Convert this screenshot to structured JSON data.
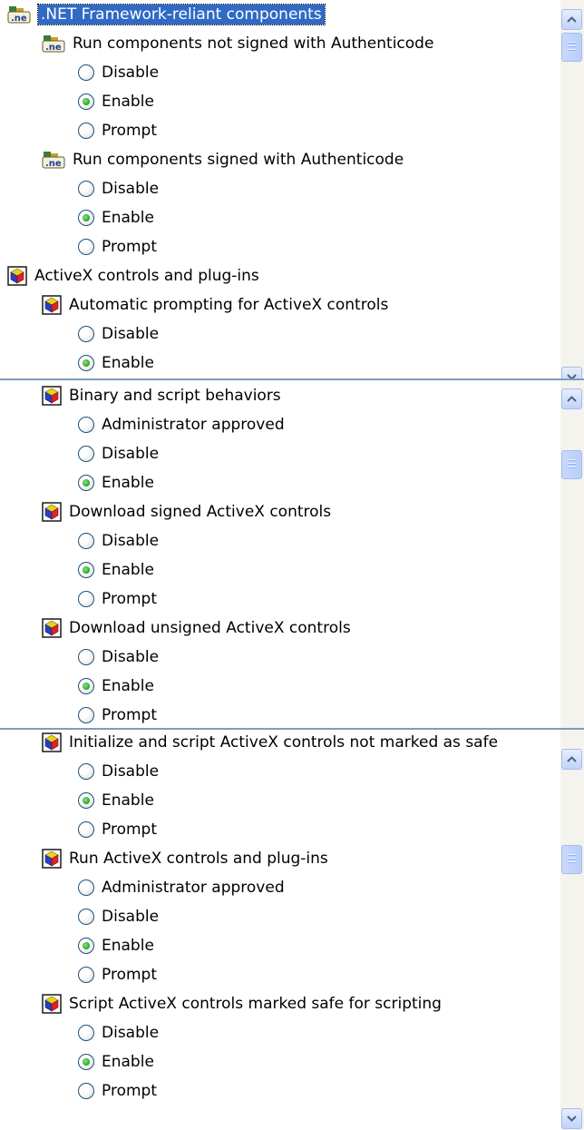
{
  "panels": [
    {
      "rows": [
        {
          "level": 0,
          "kind": "group",
          "icon": "net-components-icon",
          "label": ".NET Framework-reliant components",
          "selected": true
        },
        {
          "level": 1,
          "kind": "setting",
          "icon": "net-components-icon",
          "label": "Run components not signed with Authenticode"
        },
        {
          "level": 2,
          "kind": "option",
          "label": "Disable",
          "checked": false
        },
        {
          "level": 2,
          "kind": "option",
          "label": "Enable",
          "checked": true
        },
        {
          "level": 2,
          "kind": "option",
          "label": "Prompt",
          "checked": false
        },
        {
          "level": 1,
          "kind": "setting",
          "icon": "net-components-icon",
          "label": "Run components signed with Authenticode"
        },
        {
          "level": 2,
          "kind": "option",
          "label": "Disable",
          "checked": false
        },
        {
          "level": 2,
          "kind": "option",
          "label": "Enable",
          "checked": true
        },
        {
          "level": 2,
          "kind": "option",
          "label": "Prompt",
          "checked": false
        },
        {
          "level": 0,
          "kind": "group",
          "icon": "activex-icon",
          "label": "ActiveX controls and plug-ins"
        },
        {
          "level": 1,
          "kind": "setting",
          "icon": "activex-icon",
          "label": "Automatic prompting for ActiveX controls"
        },
        {
          "level": 2,
          "kind": "option",
          "label": "Disable",
          "checked": false
        },
        {
          "level": 2,
          "kind": "option",
          "label": "Enable",
          "checked": true
        }
      ]
    },
    {
      "rows": [
        {
          "level": 1,
          "kind": "setting",
          "icon": "activex-icon",
          "label": "Binary and script behaviors"
        },
        {
          "level": 2,
          "kind": "option",
          "label": "Administrator approved",
          "checked": false
        },
        {
          "level": 2,
          "kind": "option",
          "label": "Disable",
          "checked": false
        },
        {
          "level": 2,
          "kind": "option",
          "label": "Enable",
          "checked": true
        },
        {
          "level": 1,
          "kind": "setting",
          "icon": "activex-icon",
          "label": "Download signed ActiveX controls"
        },
        {
          "level": 2,
          "kind": "option",
          "label": "Disable",
          "checked": false
        },
        {
          "level": 2,
          "kind": "option",
          "label": "Enable",
          "checked": true
        },
        {
          "level": 2,
          "kind": "option",
          "label": "Prompt",
          "checked": false
        },
        {
          "level": 1,
          "kind": "setting",
          "icon": "activex-icon",
          "label": "Download unsigned ActiveX controls"
        },
        {
          "level": 2,
          "kind": "option",
          "label": "Disable",
          "checked": false
        },
        {
          "level": 2,
          "kind": "option",
          "label": "Enable",
          "checked": true
        },
        {
          "level": 2,
          "kind": "option",
          "label": "Prompt",
          "checked": false
        }
      ]
    },
    {
      "rows": [
        {
          "level": 1,
          "kind": "setting",
          "icon": "activex-icon",
          "label": "Initialize and script ActiveX controls not marked as safe"
        },
        {
          "level": 2,
          "kind": "option",
          "label": "Disable",
          "checked": false
        },
        {
          "level": 2,
          "kind": "option",
          "label": "Enable",
          "checked": true
        },
        {
          "level": 2,
          "kind": "option",
          "label": "Prompt",
          "checked": false
        },
        {
          "level": 1,
          "kind": "setting",
          "icon": "activex-icon",
          "label": "Run ActiveX controls and plug-ins"
        },
        {
          "level": 2,
          "kind": "option",
          "label": "Administrator approved",
          "checked": false
        },
        {
          "level": 2,
          "kind": "option",
          "label": "Disable",
          "checked": false
        },
        {
          "level": 2,
          "kind": "option",
          "label": "Enable",
          "checked": true
        },
        {
          "level": 2,
          "kind": "option",
          "label": "Prompt",
          "checked": false
        },
        {
          "level": 1,
          "kind": "setting",
          "icon": "activex-icon",
          "label": "Script ActiveX controls marked safe for scripting"
        },
        {
          "level": 2,
          "kind": "option",
          "label": "Disable",
          "checked": false
        },
        {
          "level": 2,
          "kind": "option",
          "label": "Enable",
          "checked": true
        },
        {
          "level": 2,
          "kind": "option",
          "label": "Prompt",
          "checked": false
        }
      ]
    }
  ],
  "icons": {
    "scroll_up": "chevron-up-icon",
    "scroll_down": "chevron-down-icon"
  },
  "colors": {
    "selection": "#316ac5",
    "scrollbar_button": "#c1d3fb",
    "radio_checked": "#21a121"
  }
}
